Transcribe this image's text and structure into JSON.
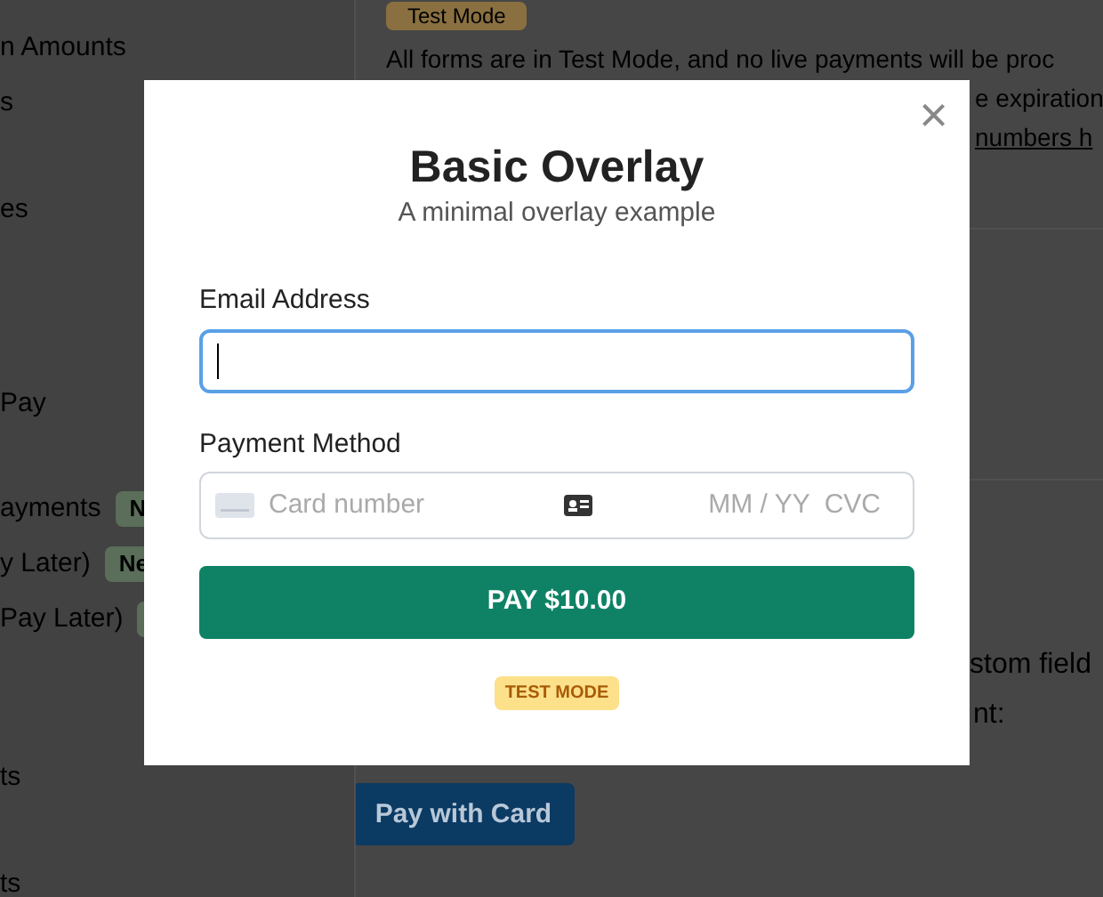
{
  "sidebar": {
    "items": [
      {
        "label": "n Amounts"
      },
      {
        "label": "s"
      },
      {
        "label": "es"
      },
      {
        "label": "Pay"
      },
      {
        "label": "ayments",
        "badge": "N"
      },
      {
        "label": "y Later)",
        "badge": "Ne"
      },
      {
        "label": "Pay Later)",
        "new_badge": true
      },
      {
        "label": "ts"
      },
      {
        "label": "ts"
      }
    ]
  },
  "content": {
    "badge": "Test Mode",
    "paragraph_lines": [
      "All forms are in Test Mode, and no live payments will be proc",
      "e expiration"
    ],
    "link": "numbers h",
    "lower_lines": [
      "stom field",
      "nt:"
    ],
    "button": "Pay with Card"
  },
  "modal": {
    "title": "Basic Overlay",
    "subtitle": "A minimal overlay example",
    "close": "×",
    "email": {
      "label": "Email Address",
      "focused": true
    },
    "payment": {
      "label": "Payment Method",
      "card_placeholder": "Card number",
      "expiry_placeholder": "MM / YY",
      "cvc_placeholder": "CVC"
    },
    "pay_button": "PAY $10.00",
    "test_badge": "TEST MODE"
  }
}
